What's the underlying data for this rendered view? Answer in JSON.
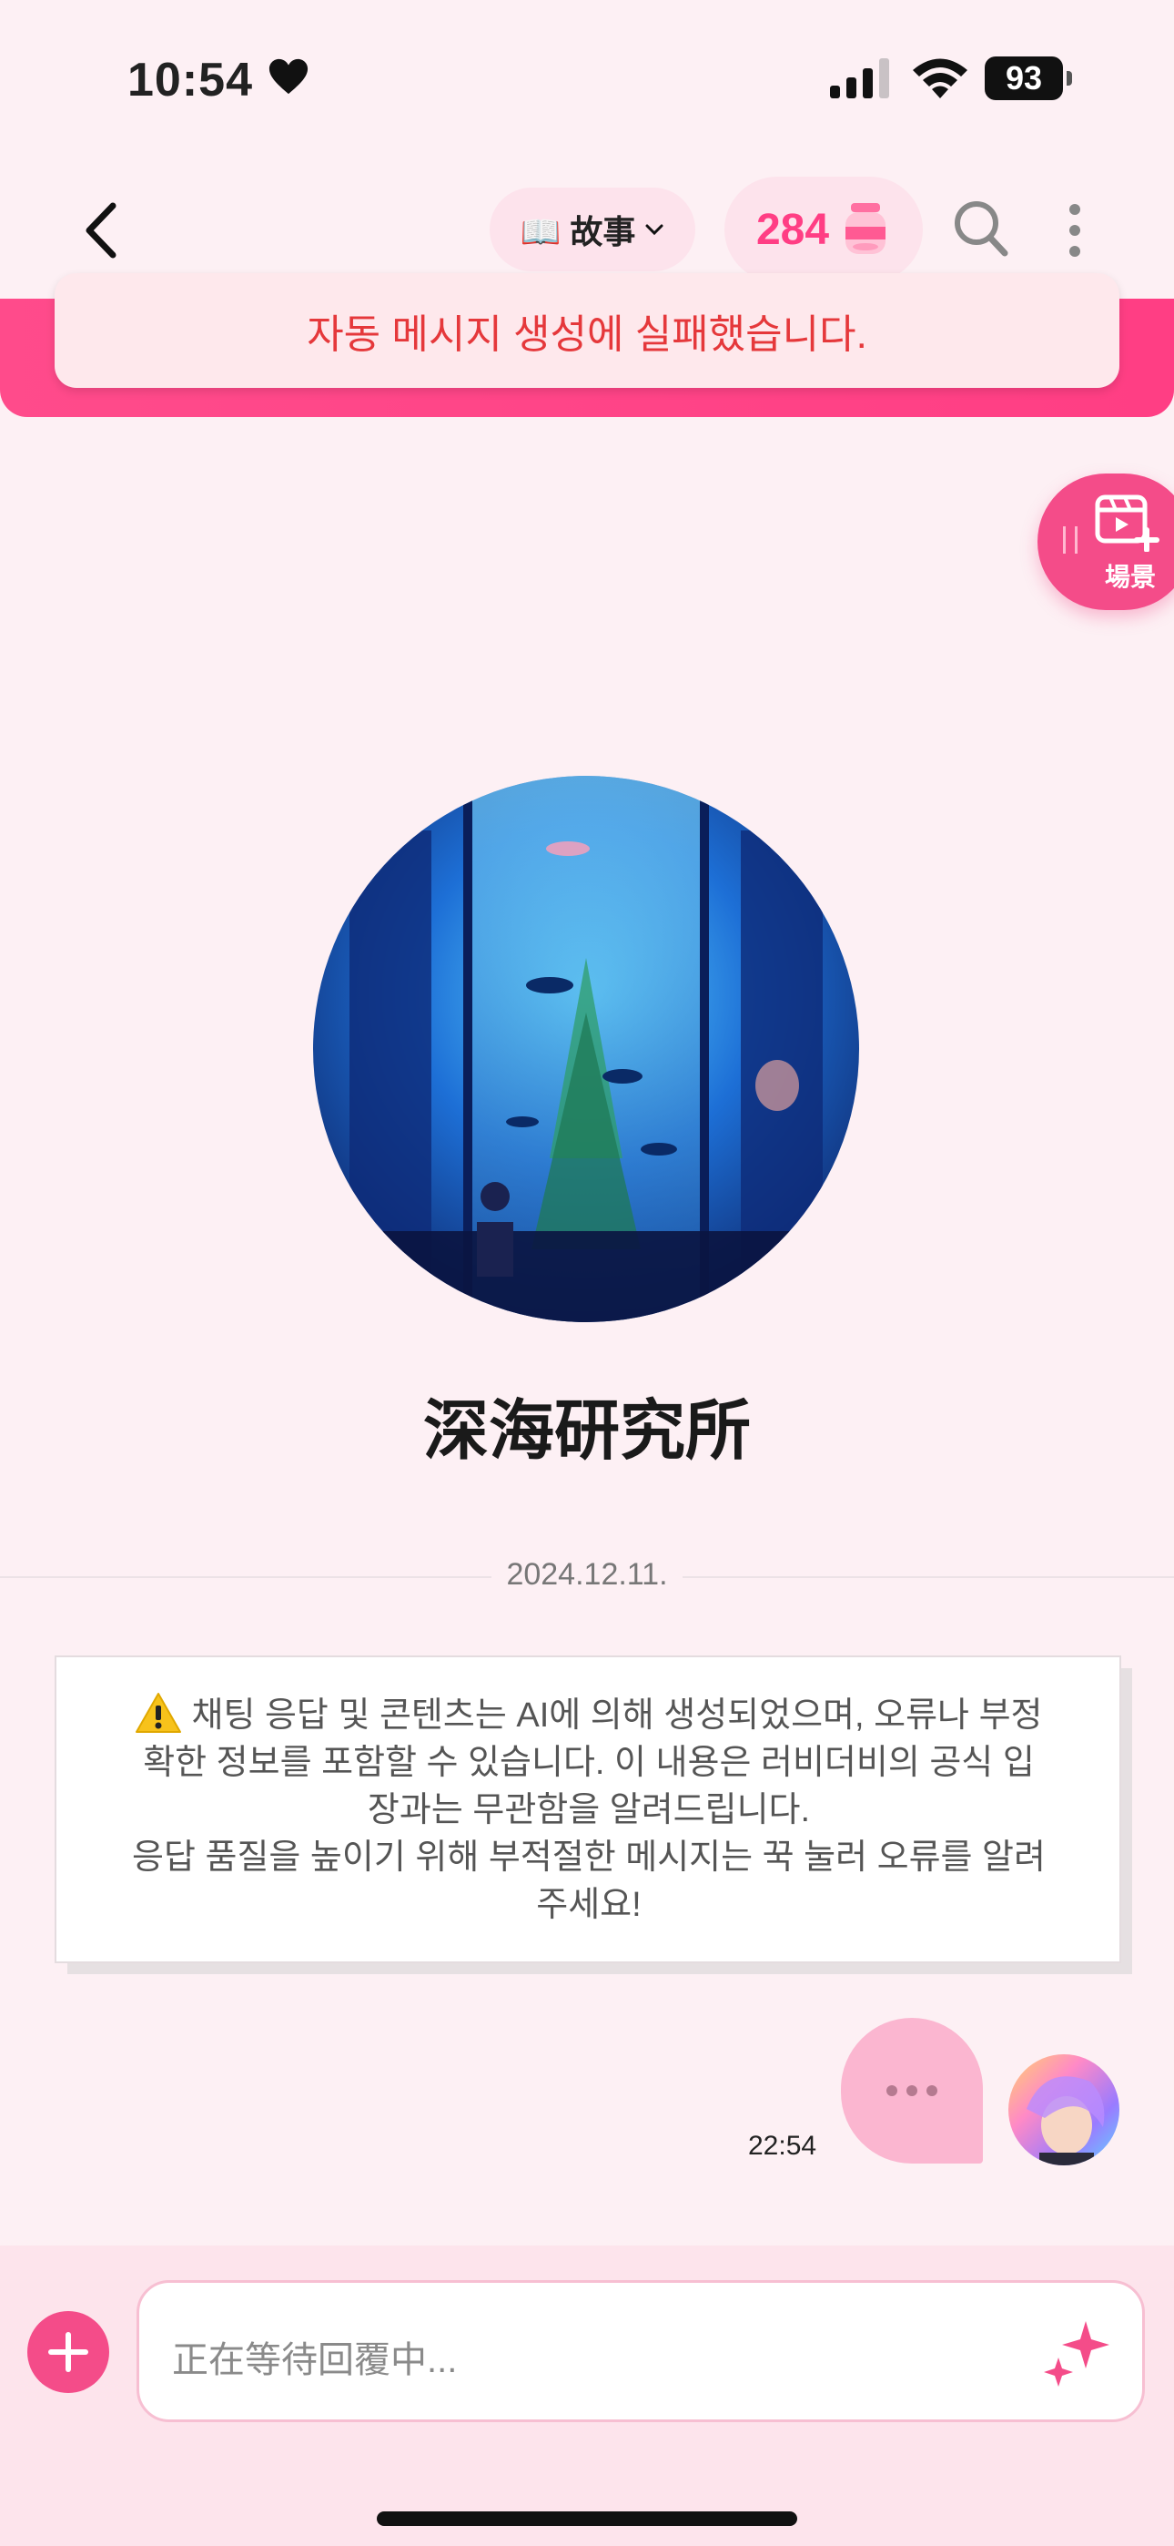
{
  "status_bar": {
    "time": "10:54",
    "battery": "93"
  },
  "header": {
    "story_label": "📖 故事",
    "coin_count": "284"
  },
  "toast": {
    "message": "자동 메시지 생성에 실패했습니다."
  },
  "scene_button": {
    "label": "場景"
  },
  "bot": {
    "name": "深海研究所"
  },
  "chat": {
    "date": "2024.12.11.",
    "notice_lines": [
      "채팅 응답 및 콘텐츠는 AI에 의해 생성되었으며, 오류나 부정",
      "확한 정보를 포함할 수 있습니다. 이 내용은 러비더비의 공식 입",
      "장과는 무관함을 알려드립니다.",
      "응답 품질을 높이기 위해 부적절한 메시지는 꾹 눌러 오류를 알려",
      "주세요!"
    ],
    "message_time": "22:54"
  },
  "input": {
    "placeholder": "正在等待回覆中..."
  },
  "colors": {
    "accent": "#f44c89",
    "toast_text": "#e5383b",
    "background": "#fdf0f4"
  }
}
